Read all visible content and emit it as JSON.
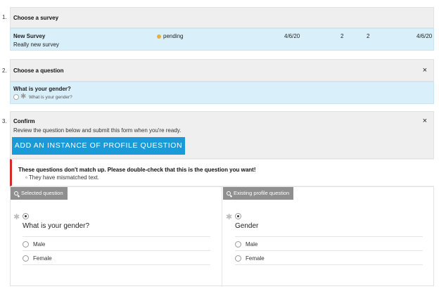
{
  "steps": {
    "step1": {
      "number": "1.",
      "title": "Choose a survey"
    },
    "step2": {
      "number": "2.",
      "title": "Choose a question"
    },
    "step3": {
      "number": "3.",
      "title": "Confirm",
      "description": "Review the question below and submit this form when you're ready."
    }
  },
  "survey": {
    "name": "New Survey",
    "description": "Really new survey",
    "status": "pending",
    "status_color": "#e2b23a",
    "date_created": "4/6/20",
    "count_a": "2",
    "count_b": "2",
    "date_modified": "4/6/20"
  },
  "question": {
    "title": "What is your gender?",
    "preview": "What is your gender?"
  },
  "actions": {
    "close_icon": "×",
    "add_button": "ADD AN INSTANCE OF PROFILE QUESTION"
  },
  "warning": {
    "title": "These questions don't match up. Please double-check that this is the question you want!",
    "reasons": [
      "They have mismatched text."
    ],
    "accent_color": "#d42b2b"
  },
  "compare": {
    "left": {
      "tag": "Selected question",
      "question": "What is your gender?",
      "options": [
        "Male",
        "Female"
      ]
    },
    "right": {
      "tag": "Existing profile question",
      "question": "Gender",
      "options": [
        "Male",
        "Female"
      ]
    }
  },
  "colors": {
    "accent": "#1a9ad7",
    "selected_row": "#d9f0fb",
    "header_bg": "#efefef"
  }
}
